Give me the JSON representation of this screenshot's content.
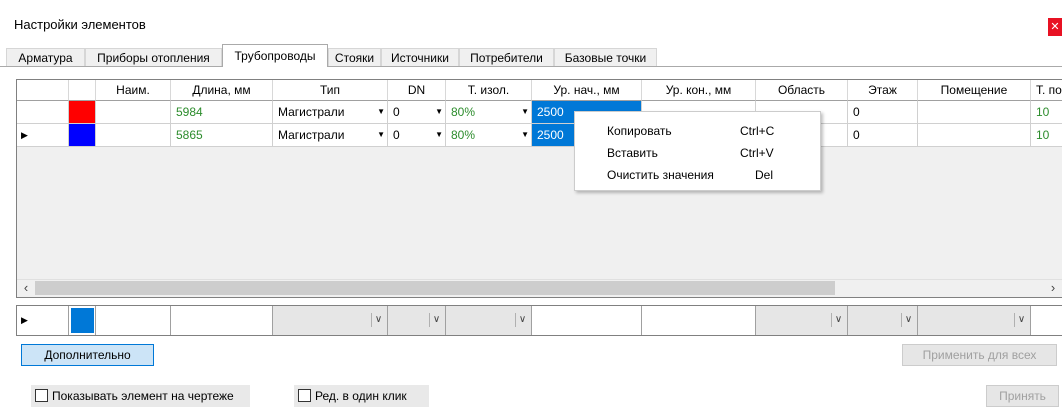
{
  "window": {
    "title": "Настройки элементов",
    "close_icon": "close-icon"
  },
  "tabs": [
    {
      "label": "Арматура"
    },
    {
      "label": "Приборы отопления"
    },
    {
      "label": "Трубопроводы",
      "active": true
    },
    {
      "label": "Стояки"
    },
    {
      "label": "Источники"
    },
    {
      "label": "Потребители"
    },
    {
      "label": "Базовые точки"
    }
  ],
  "grid": {
    "headers": [
      "Наим.",
      "Длина, мм",
      "Тип",
      "DN",
      "Т. изол.",
      "Ур. нач., мм",
      "Ур. кон., мм",
      "Область",
      "Этаж",
      "Помещение",
      "Т. по"
    ],
    "rows": [
      {
        "color": "#ff0000",
        "name": "",
        "length": "5984",
        "type": "Магистрали",
        "dn": "0",
        "insulation": "80%",
        "start_level": "2500",
        "end_level": "",
        "area": "",
        "floor": "0",
        "room": "",
        "t": "10"
      },
      {
        "color": "#0000ff",
        "name": "",
        "length": "5865",
        "type": "Магистрали",
        "dn": "0",
        "insulation": "80%",
        "start_level": "2500",
        "end_level": "",
        "area": "",
        "floor": "0",
        "room": "",
        "t": "10",
        "current": true
      }
    ]
  },
  "context_menu": [
    {
      "label": "Копировать",
      "shortcut": "Ctrl+C"
    },
    {
      "label": "Вставить",
      "shortcut": "Ctrl+V"
    },
    {
      "label": "Очистить значения",
      "shortcut": "Del"
    }
  ],
  "filter_row": {
    "color": "#0078d7"
  },
  "buttons": {
    "more": "Дополнительно",
    "apply_all": "Применить для всех",
    "accept": "Принять"
  },
  "checkboxes": {
    "show_on_drawing": "Показывать элемент на чертеже",
    "one_click_edit": "Ред. в один клик"
  }
}
